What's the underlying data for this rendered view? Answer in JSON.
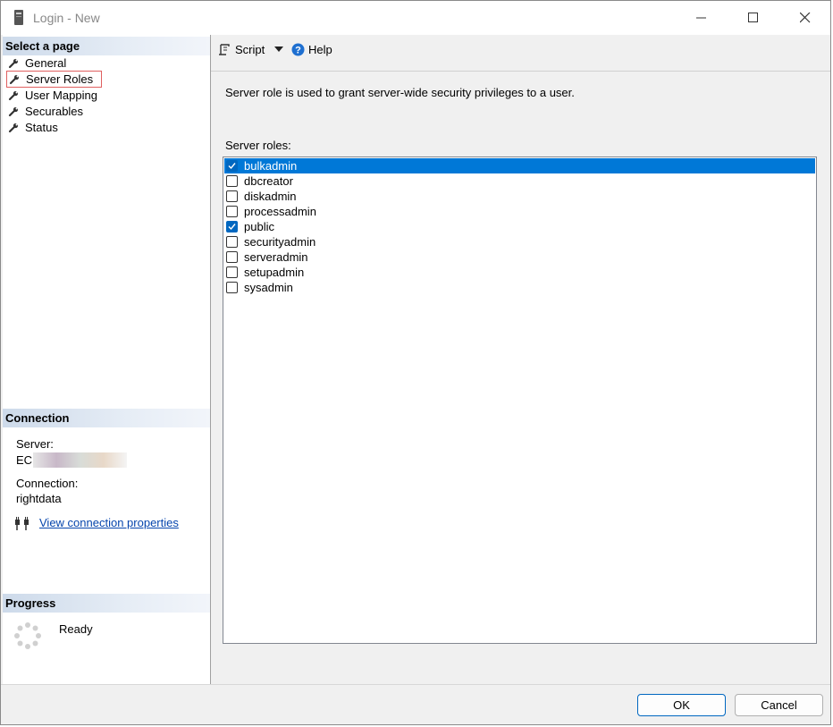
{
  "window": {
    "title": "Login - New",
    "minimize_glyph": "—",
    "maximize_glyph": "☐",
    "close_glyph": "✕"
  },
  "left": {
    "select_page_header": "Select a page",
    "pages": [
      {
        "label": "General",
        "icon": "wrench-icon"
      },
      {
        "label": "Server Roles",
        "icon": "wrench-icon",
        "selected": true
      },
      {
        "label": "User Mapping",
        "icon": "wrench-icon"
      },
      {
        "label": "Securables",
        "icon": "wrench-icon"
      },
      {
        "label": "Status",
        "icon": "wrench-icon"
      }
    ],
    "connection_header": "Connection",
    "server_label": "Server:",
    "server_value": "EC",
    "connection_label": "Connection:",
    "connection_value": "rightdata",
    "view_connection_link": "View connection properties",
    "progress_header": "Progress",
    "progress_status": "Ready"
  },
  "toolbar": {
    "script_label": "Script",
    "help_label": "Help"
  },
  "content": {
    "description": "Server role is used to grant server-wide security privileges to a user.",
    "roles_label": "Server roles:",
    "roles": [
      {
        "name": "bulkadmin",
        "checked": true,
        "selected": true
      },
      {
        "name": "dbcreator",
        "checked": false
      },
      {
        "name": "diskadmin",
        "checked": false
      },
      {
        "name": "processadmin",
        "checked": false
      },
      {
        "name": "public",
        "checked": true
      },
      {
        "name": "securityadmin",
        "checked": false
      },
      {
        "name": "serveradmin",
        "checked": false
      },
      {
        "name": "setupadmin",
        "checked": false
      },
      {
        "name": "sysadmin",
        "checked": false
      }
    ]
  },
  "footer": {
    "ok_label": "OK",
    "cancel_label": "Cancel"
  },
  "colors": {
    "selection": "#0078d7",
    "checkbox_checked": "#0067c0",
    "link": "#0645ad",
    "highlight_border": "#e06060"
  }
}
